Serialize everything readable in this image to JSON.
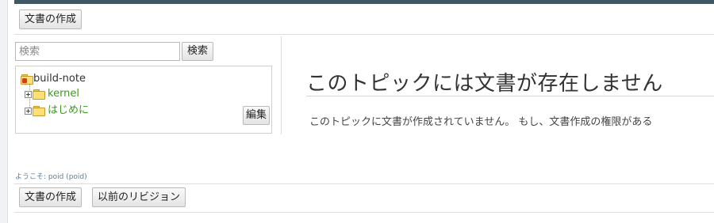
{
  "toolbar_top": {
    "create_doc_label": "文書の作成"
  },
  "search": {
    "placeholder": "検索",
    "button_label": "検索"
  },
  "tree": {
    "root_label": "build-note",
    "items": [
      {
        "label": "kernel"
      },
      {
        "label": "はじめに"
      }
    ],
    "edit_label": "編集"
  },
  "main": {
    "heading": "このトピックには文書が存在しません",
    "message": "このトピックに文書が作成されていません。 もし、文書作成の権限がある"
  },
  "footer": {
    "welcome": "ようこそ: poid (poid)",
    "create_doc_label": "文書の作成",
    "previous_revision_label": "以前のリビジョン"
  },
  "colors": {
    "accent_bar": "#3f5864",
    "link_green": "#3c9a1e",
    "welcome_blue": "#5a7f99"
  },
  "icons": [
    "folder-open-icon",
    "folder-icon",
    "expand-plus-icon"
  ]
}
